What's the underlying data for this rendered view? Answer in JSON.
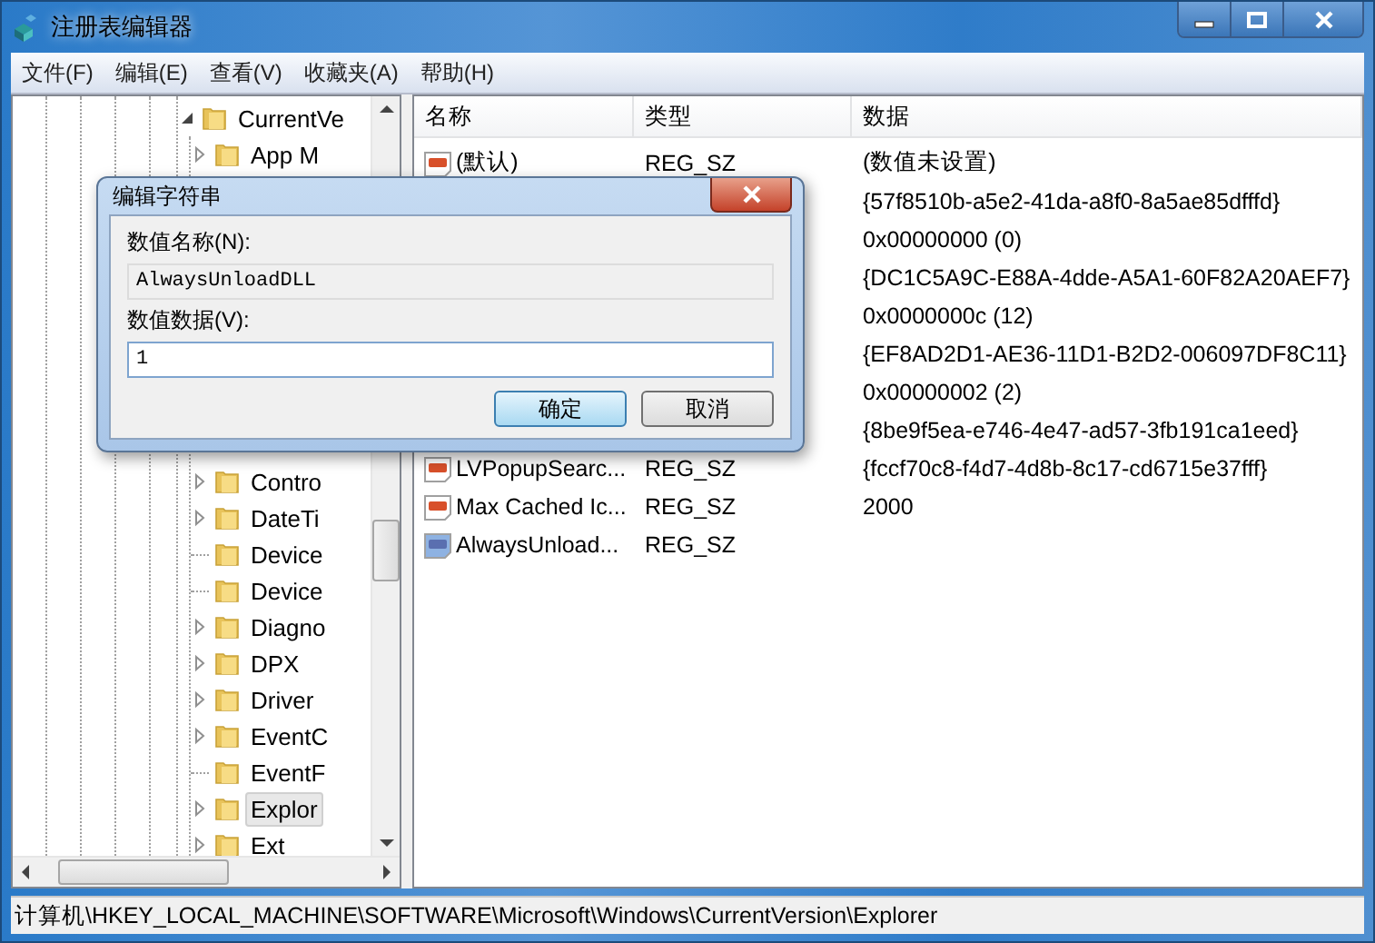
{
  "window": {
    "title": "注册表编辑器"
  },
  "menu": [
    "文件(F)",
    "编辑(E)",
    "查看(V)",
    "收藏夹(A)",
    "帮助(H)"
  ],
  "tree": {
    "label": "CurrentVe",
    "kind": "branch",
    "expanded": true,
    "selected": false,
    "children": [
      {
        "label": "App M",
        "kind": "branch",
        "expanded": false,
        "selected": false
      },
      {
        "label": "Contro",
        "kind": "branch",
        "expanded": false,
        "selected": false
      },
      {
        "label": "DateTi",
        "kind": "branch",
        "expanded": false,
        "selected": false
      },
      {
        "label": "Device",
        "kind": "leaf",
        "selected": false
      },
      {
        "label": "Device",
        "kind": "leaf",
        "selected": false
      },
      {
        "label": "Diagno",
        "kind": "branch",
        "expanded": false,
        "selected": false
      },
      {
        "label": "DPX",
        "kind": "branch",
        "expanded": false,
        "selected": false
      },
      {
        "label": "Driver",
        "kind": "branch",
        "expanded": false,
        "selected": false
      },
      {
        "label": "EventC",
        "kind": "branch",
        "expanded": false,
        "selected": false
      },
      {
        "label": "EventF",
        "kind": "leaf",
        "selected": false
      },
      {
        "label": "Explor",
        "kind": "branch",
        "expanded": false,
        "selected": true
      },
      {
        "label": "Ext",
        "kind": "branch",
        "expanded": false,
        "selected": false
      }
    ]
  },
  "table": {
    "columns": [
      "名称",
      "类型",
      "数据"
    ],
    "rows": [
      {
        "kind": "string",
        "name": "(默认)",
        "type": "REG_SZ",
        "data": "(数值未设置)"
      },
      {
        "data": "{57f8510b-a5e2-41da-a8f0-8a5ae85dfffd}"
      },
      {
        "data": "0x00000000 (0)"
      },
      {
        "data": "{DC1C5A9C-E88A-4dde-A5A1-60F82A20AEF7}"
      },
      {
        "data": "0x0000000c (12)"
      },
      {
        "data": "{EF8AD2D1-AE36-11D1-B2D2-006097DF8C11}"
      },
      {
        "data": "0x00000002 (2)"
      },
      {
        "data": "{8be9f5ea-e746-4e47-ad57-3fb191ca1eed}"
      },
      {
        "kind": "string",
        "name": "LVPopupSearc...",
        "type": "REG_SZ",
        "data": "{fccf70c8-f4d7-4d8b-8c17-cd6715e37fff}"
      },
      {
        "kind": "string",
        "name": "Max Cached Ic...",
        "type": "REG_SZ",
        "data": "2000"
      },
      {
        "kind": "editing",
        "name": "AlwaysUnload...",
        "type": "REG_SZ"
      }
    ]
  },
  "dialog": {
    "title": "编辑字符串",
    "name_label": "数值名称(N):",
    "name_value": "AlwaysUnloadDLL",
    "data_label": "数值数据(V):",
    "data_value": "1",
    "buttons": [
      {
        "label": "确定",
        "default": true
      },
      {
        "label": "取消",
        "default": false
      }
    ]
  },
  "status_bar": "计算机\\HKEY_LOCAL_MACHINE\\SOFTWARE\\Microsoft\\Windows\\CurrentVersion\\Explorer"
}
